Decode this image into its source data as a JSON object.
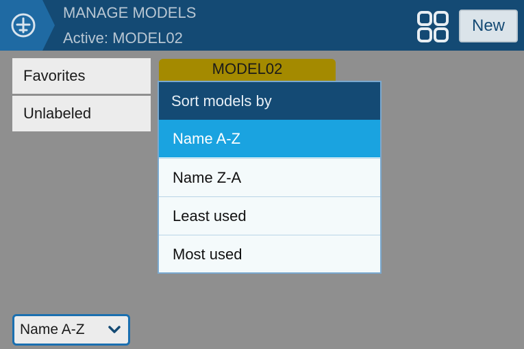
{
  "header": {
    "title": "MANAGE MODELS",
    "subtitle": "Active: MODEL02",
    "icon": "plane-icon",
    "grid_icon": "grid-view-icon",
    "new_label": "New"
  },
  "labels": {
    "items": [
      {
        "label": "Favorites"
      },
      {
        "label": "Unlabeled"
      }
    ]
  },
  "models": {
    "tiles": [
      {
        "name": "MODEL02"
      }
    ]
  },
  "sort_select": {
    "value": "Name A-Z",
    "icon": "chevron-down-icon"
  },
  "sort_popup": {
    "title": "Sort models by",
    "options": [
      {
        "label": "Name A-Z",
        "selected": true
      },
      {
        "label": "Name Z-A",
        "selected": false
      },
      {
        "label": "Least used",
        "selected": false
      },
      {
        "label": "Most used",
        "selected": false
      }
    ]
  },
  "colors": {
    "header_bg": "#144a74",
    "accent": "#1aa3e0",
    "model_tile": "#a48a00",
    "overlay": "#8f8f8f"
  }
}
